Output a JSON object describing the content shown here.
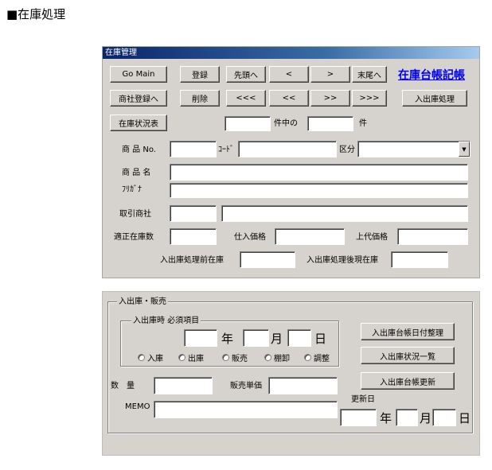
{
  "page_heading": "■在庫処理",
  "window": {
    "title": "在庫管理",
    "header_link": "在庫台帳記帳",
    "buttons": {
      "go_main": "Go Main",
      "register": "登録",
      "first": "先頭へ",
      "prev": "<",
      "next": ">",
      "last": "末尾へ",
      "trading_register": "商社登録へ",
      "delete": "削除",
      "first_page": "<<<",
      "prev_page": "<<",
      "next_page": ">>",
      "last_page": ">>>",
      "in_out_process": "入出庫処理",
      "stock_status": "在庫状況表"
    },
    "record_counter": {
      "of_label": "件中の",
      "count_suffix": "件",
      "current": "",
      "total": ""
    },
    "fields": {
      "product_no_label": "商 品 No.",
      "code_label": "ｺｰﾄﾞ",
      "category_label": "区分",
      "product_name_label": "商 品 名",
      "furigana_label": "ﾌﾘｶﾞﾅ",
      "trading_company_label": "取引商社",
      "proper_stock_label": "適正在庫数",
      "purchase_price_label": "仕入価格",
      "retail_price_label": "上代価格",
      "stock_before_label": "入出庫処理前在庫",
      "stock_after_label": "入出庫処理後現在庫",
      "product_no": "",
      "code": "",
      "category": "",
      "product_name": "",
      "furigana": "",
      "trading_company_code": "",
      "trading_company_name": "",
      "proper_stock": "",
      "purchase_price": "",
      "retail_price": "",
      "stock_before": "",
      "stock_after": ""
    }
  },
  "inout": {
    "group_title": "入出庫・販売",
    "required_title": "入出庫時  必須項目",
    "year_unit": "年",
    "month_unit": "月",
    "day_unit": "日",
    "radios": [
      "入庫",
      "出庫",
      "販売",
      "棚卸",
      "調整"
    ],
    "quantity_label": "数　量",
    "unit_price_label": "販売単価",
    "memo_label": "MEMO",
    "update_date_label": "更新日",
    "buttons": {
      "ledger_date_sort": "入出庫台帳日付整理",
      "status_list": "入出庫状況一覧",
      "ledger_update": "入出庫台帳更新"
    },
    "values": {
      "year": "",
      "month": "",
      "day": "",
      "quantity": "",
      "unit_price": "",
      "memo": "",
      "upd_year": "",
      "upd_month": "",
      "upd_day": ""
    }
  }
}
